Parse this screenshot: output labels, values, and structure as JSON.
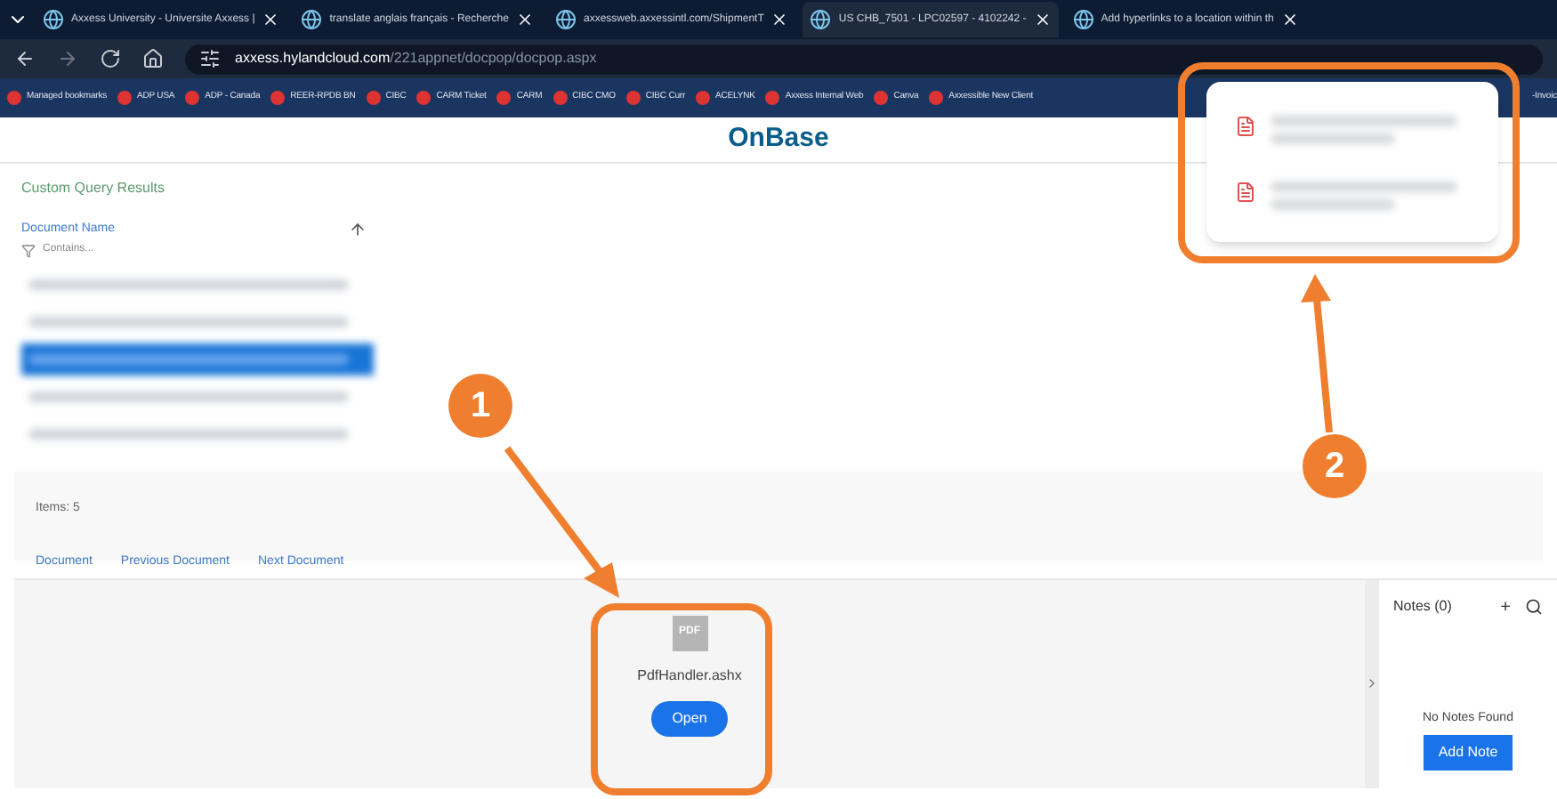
{
  "browser": {
    "tabs": [
      {
        "title": "Axxess University - Universite Axxess |",
        "selected": false
      },
      {
        "title": "translate anglais français - Recherche",
        "selected": false
      },
      {
        "title": "axxessweb.axxessintl.com/ShipmentT",
        "selected": false
      },
      {
        "title": "US CHB_7501 - LPC02597 - 4102242 -",
        "selected": true
      },
      {
        "title": "Add hyperlinks to a location within th",
        "selected": false
      }
    ],
    "address": {
      "domain": "axxess.hylandcloud.com",
      "path": "/221appnet/docpop/docpop.aspx"
    },
    "bookmarks": [
      "Managed bookmarks",
      "ADP USA",
      "ADP - Canada",
      "REER-RPDB BN",
      "CIBC",
      "CARM Ticket",
      "CARM",
      "CIBC CMO",
      "CIBC Curr",
      "ACELYNK",
      "Axxess Internal Web",
      "Canva",
      "Axxessible New Client"
    ],
    "bookmarks_end": "-Invoic",
    "downloads": [
      {
        "kind": "pdf"
      },
      {
        "kind": "pdf"
      }
    ]
  },
  "page": {
    "logo": "OnBase",
    "section_title": "Custom Query Results",
    "list": {
      "column": "Document Name",
      "filter_placeholder": "Contains...",
      "rows": [
        {
          "selected": false
        },
        {
          "selected": false
        },
        {
          "selected": true
        },
        {
          "selected": false
        },
        {
          "selected": false
        }
      ],
      "count": "Items: 5"
    },
    "nav_links": [
      "Document",
      "Previous Document",
      "Next Document"
    ],
    "viewer": {
      "file_icon": "PDF",
      "file_name": "PdfHandler.ashx",
      "button": "Open"
    },
    "notes": {
      "title": "Notes (0)",
      "add": "+",
      "empty": "No Notes Found",
      "button": "Add Note"
    }
  },
  "callouts": [
    "1",
    "2"
  ]
}
